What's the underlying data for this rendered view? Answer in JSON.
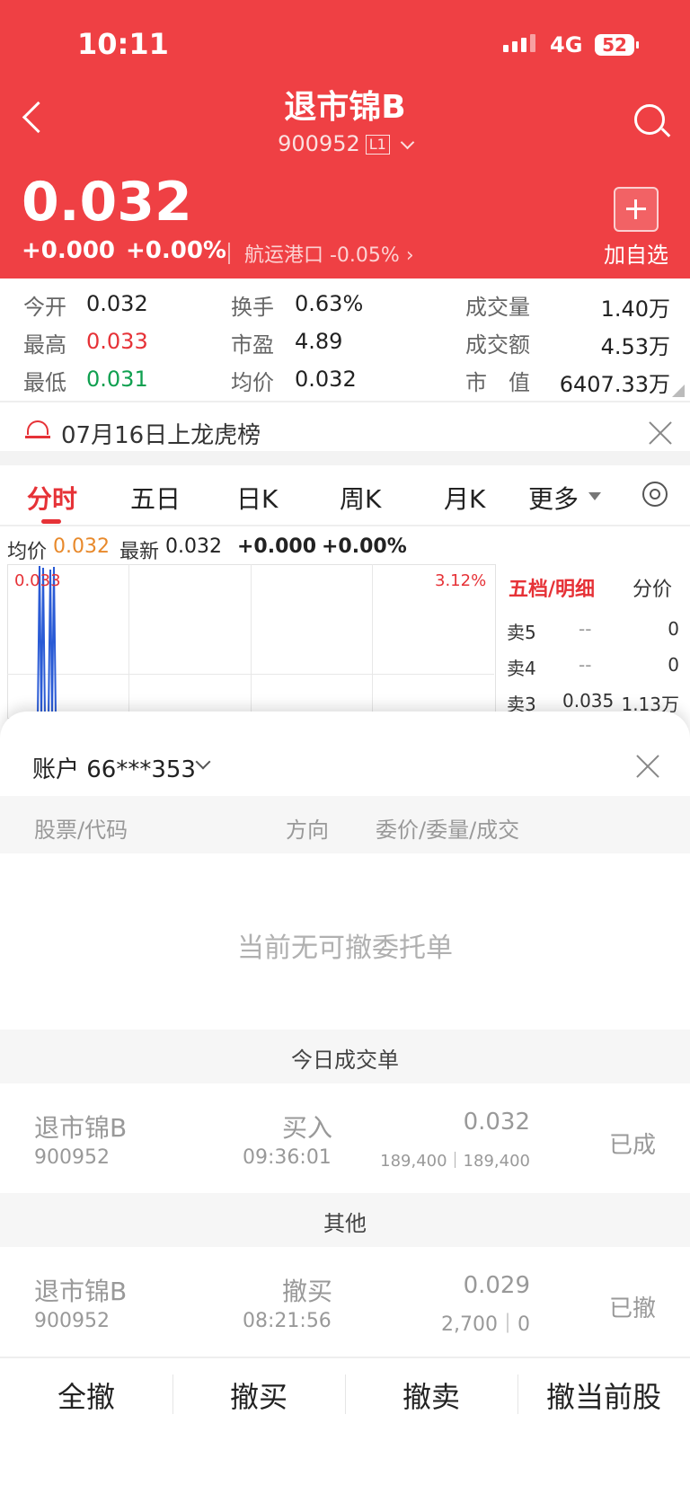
{
  "status_bar": {
    "time": "10:11",
    "network": "4G",
    "battery": "52"
  },
  "header": {
    "stock_name": "退市锦B",
    "stock_code": "900952",
    "level_badge": "L1",
    "price": "0.032",
    "change": "+0.000",
    "change_pct": "+0.00%",
    "sector": "航运港口 -0.05%",
    "sector_arrow": "›",
    "add_label": "加自选"
  },
  "stats": {
    "open_label": "今开",
    "open_value": "0.032",
    "high_label": "最高",
    "high_value": "0.033",
    "low_label": "最低",
    "low_value": "0.031",
    "turnover_label": "换手",
    "turnover_value": "0.63%",
    "pe_label": "市盈",
    "pe_value": "4.89",
    "avg_label": "均价",
    "avg_value": "0.032",
    "volume_label": "成交量",
    "volume_value": "1.40万",
    "amount_label": "成交额",
    "amount_value": "4.53万",
    "mktcap_label": "市　值",
    "mktcap_value": "6407.33万"
  },
  "notice": {
    "text": "07月16日上龙虎榜"
  },
  "tabs": [
    "分时",
    "五日",
    "日K",
    "周K",
    "月K",
    "更多"
  ],
  "chart_info": {
    "avg_label": "均价",
    "avg_value": "0.032",
    "latest_label": "最新",
    "latest_value": "0.032",
    "change": "+0.000",
    "change_pct": "+0.00%",
    "top_left": "0.033",
    "top_right": "3.12%"
  },
  "order_book": {
    "tab_active": "五档/明细",
    "tab_other": "分价",
    "rows": [
      {
        "label": "卖5",
        "price": "--",
        "vol": "0"
      },
      {
        "label": "卖4",
        "price": "--",
        "vol": "0"
      },
      {
        "label": "卖3",
        "price": "0.035",
        "vol": "1.13万"
      }
    ]
  },
  "sheet": {
    "account": "账户 66***353",
    "col_stock": "股票/代码",
    "col_direction": "方向",
    "col_price": "委价/委量/成交",
    "empty_text": "当前无可撤委托单",
    "section_today": "今日成交单",
    "section_other": "其他",
    "today_rows": [
      {
        "name": "退市锦B",
        "code": "900952",
        "direction": "买入",
        "time": "09:36:01",
        "price": "0.032",
        "qty": "189,400｜189,400",
        "status": "已成"
      }
    ],
    "other_rows": [
      {
        "name": "退市锦B",
        "code": "900952",
        "direction": "撤买",
        "time": "08:21:56",
        "price": "0.029",
        "qty": "2,700｜0",
        "status": "已撤"
      }
    ]
  },
  "bottom_actions": [
    "全撤",
    "撤买",
    "撤卖",
    "撤当前股"
  ]
}
